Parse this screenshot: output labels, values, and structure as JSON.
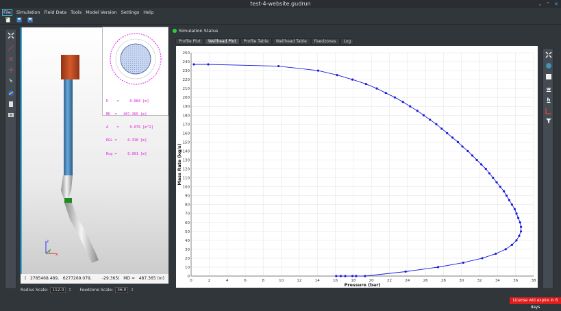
{
  "window": {
    "title": "test-4-website.gudrun"
  },
  "menu": [
    "File",
    "Simulation",
    "Field Data",
    "Tools",
    "Model Version",
    "Settings",
    "Help"
  ],
  "status": {
    "label": "Simulation Status",
    "color": "#27d13a"
  },
  "tabs": [
    "Profile Plot",
    "Wellhead Plot",
    "Profile Table",
    "Wellhead Table",
    "Feedzones",
    "Log"
  ],
  "active_tab": "Wellhead Plot",
  "cross_section": {
    "lines": [
      "D    =     0.084 [m]",
      "MD  =   487.365 [m]",
      "A    =     0.079 [m^2]",
      "RGL =     0.318 [m]",
      "Rug =     0.001 [m]"
    ]
  },
  "readout": {
    "coords": "(   2785468.489,   6277269.079,        -29.365)",
    "md": "MD =   487.365 (m)"
  },
  "controls": {
    "radius_label": "Radius Scale:",
    "radius_value": "112.0",
    "feedzone_label": "Feedzone Scale:",
    "feedzone_value": "36.0"
  },
  "license": "License will expire in 6 days",
  "colors": {
    "accent": "#3daee9",
    "series": "#1a1adf",
    "casing_top": "#b5451f",
    "casing": "#3f7fb5",
    "feedzone": "#1f8a1f",
    "license_bg": "#e01b1b"
  },
  "chart_data": {
    "type": "scatter",
    "xlabel": "Pressure (bar)",
    "ylabel": "Mass Rate (kg/s)",
    "xlim": [
      0,
      38
    ],
    "ylim": [
      0,
      250
    ],
    "xticks": [
      0,
      2,
      4,
      6,
      8,
      10,
      12,
      14,
      16,
      18,
      20,
      22,
      24,
      26,
      28,
      30,
      32,
      34,
      36,
      38
    ],
    "yticks": [
      0,
      10,
      20,
      30,
      40,
      50,
      60,
      70,
      80,
      90,
      100,
      110,
      120,
      130,
      140,
      150,
      160,
      170,
      180,
      190,
      200,
      210,
      220,
      230,
      240,
      250
    ],
    "grid": true,
    "series": [
      {
        "x": [
          16.1,
          16.6,
          17.1,
          17.9,
          18.3,
          19.3,
          23.8,
          27.4,
          30.2,
          32.3,
          33.8,
          34.9,
          35.6,
          36.1,
          36.4,
          36.6,
          36.6,
          36.5,
          36.3,
          36.1,
          35.9,
          35.6,
          35.3,
          35.0,
          34.7,
          34.3,
          33.9,
          33.5,
          33.1,
          32.7,
          32.2,
          31.7,
          31.2,
          30.7,
          30.1,
          29.6,
          29.0,
          28.4,
          27.8,
          27.2,
          26.5,
          25.8,
          25.1,
          24.3,
          23.5,
          22.6,
          21.6,
          20.6,
          19.4,
          17.9,
          16.2,
          14.1,
          9.7,
          1.9,
          0.3
        ],
        "y": [
          0,
          0,
          0,
          0,
          0,
          0,
          5,
          10,
          15,
          20,
          25,
          30,
          35,
          40,
          45,
          50,
          55,
          60,
          65,
          70,
          75,
          80,
          85,
          90,
          95,
          100,
          105,
          110,
          115,
          120,
          125,
          130,
          135,
          140,
          145,
          150,
          155,
          160,
          165,
          170,
          175,
          180,
          185,
          190,
          195,
          200,
          205,
          210,
          215,
          220,
          225,
          230,
          235,
          237,
          237
        ]
      }
    ]
  }
}
